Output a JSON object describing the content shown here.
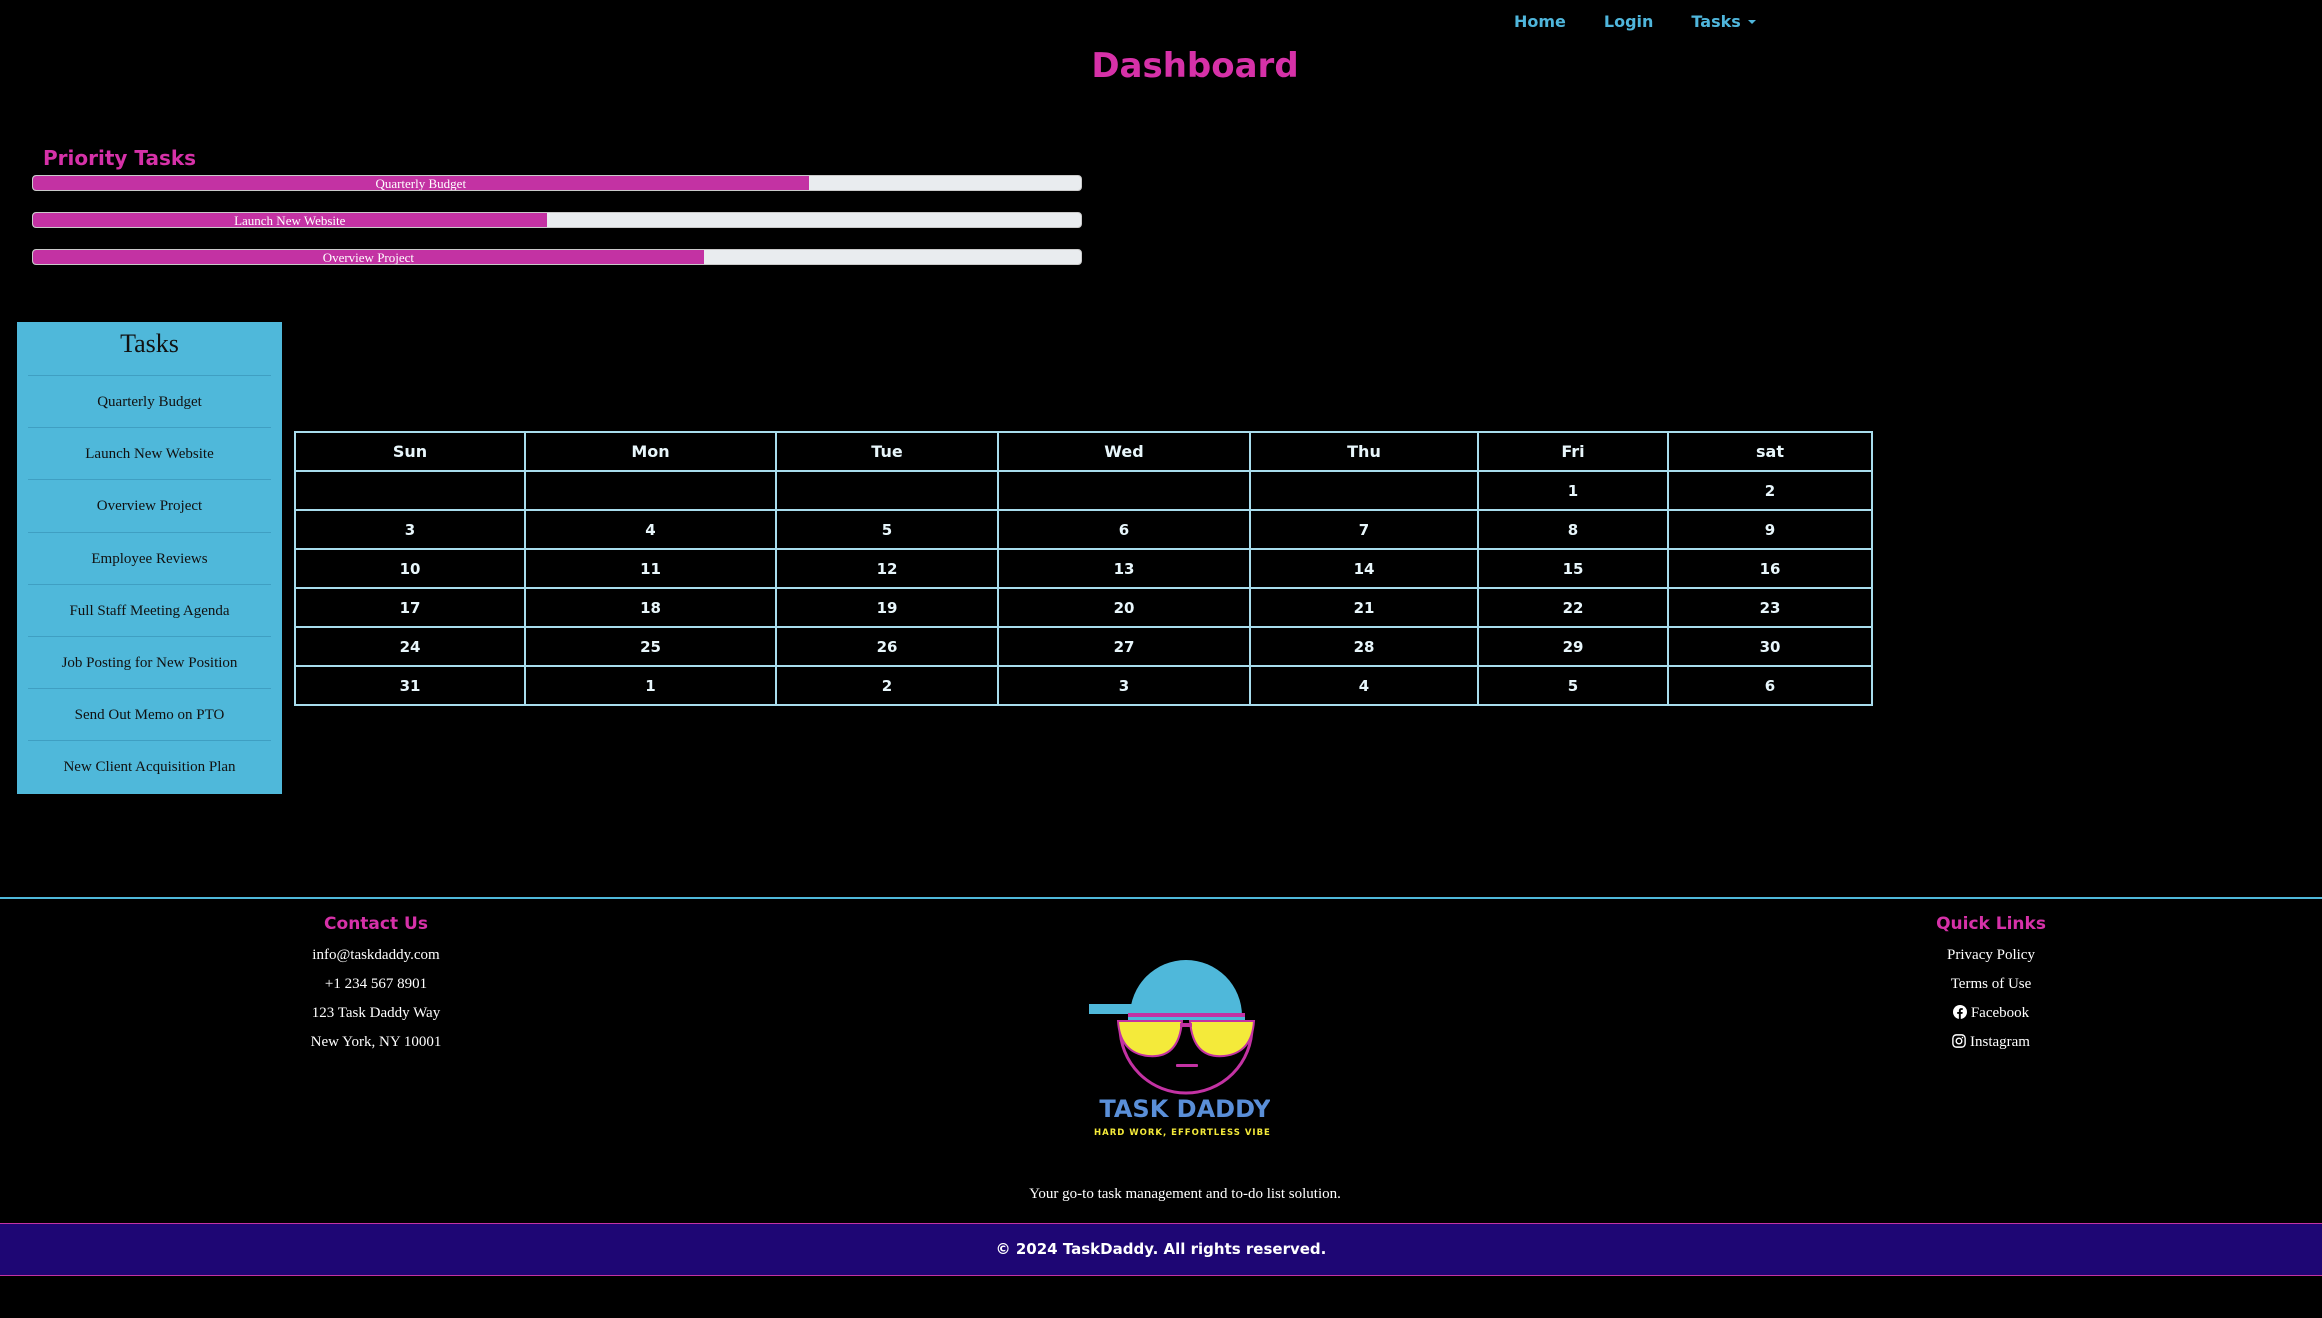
{
  "nav": {
    "home": "Home",
    "login": "Login",
    "tasks": "Tasks"
  },
  "dashboard_title": "Dashboard",
  "priority": {
    "title": "Priority Tasks",
    "items": [
      {
        "label": "Quarterly Budget",
        "progress_pct": 74
      },
      {
        "label": "Launch New Website",
        "progress_pct": 49
      },
      {
        "label": "Overview Project",
        "progress_pct": 64
      }
    ]
  },
  "task_panel": {
    "title": "Tasks",
    "items": [
      "Quarterly Budget",
      "Launch New Website",
      "Overview Project",
      "Employee Reviews",
      "Full Staff Meeting Agenda",
      "Job Posting for New Position",
      "Send Out Memo on PTO",
      "New Client Acquisition Plan"
    ]
  },
  "calendar": {
    "days": [
      "Sun",
      "Mon",
      "Tue",
      "Wed",
      "Thu",
      "Fri",
      "sat"
    ],
    "weeks": [
      [
        "",
        "",
        "",
        "",
        "",
        "1",
        "2"
      ],
      [
        "3",
        "4",
        "5",
        "6",
        "7",
        "8",
        "9"
      ],
      [
        "10",
        "11",
        "12",
        "13",
        "14",
        "15",
        "16"
      ],
      [
        "17",
        "18",
        "19",
        "20",
        "21",
        "22",
        "23"
      ],
      [
        "24",
        "25",
        "26",
        "27",
        "28",
        "29",
        "30"
      ],
      [
        "31",
        "1",
        "2",
        "3",
        "4",
        "5",
        "6"
      ]
    ]
  },
  "contact": {
    "title": "Contact Us",
    "email": "info@taskdaddy.com",
    "phone": "+1 234 567 8901",
    "street": "123 Task Daddy Way",
    "city": "New York, NY 10001"
  },
  "quick_links": {
    "title": "Quick Links",
    "privacy": "Privacy Policy",
    "terms": "Terms of Use",
    "facebook": "Facebook",
    "instagram": "Instagram"
  },
  "logo": {
    "name": "TASK DADDY",
    "slogan": "HARD WORK, EFFORTLESS VIBES"
  },
  "tagline": "Your go-to task management and to-do list solution.",
  "copyright": "© 2024 TaskDaddy. All rights reserved.",
  "colors": {
    "accent_pink": "#d631a8",
    "accent_blue": "#4fb8da",
    "footer_bar": "#1e0674",
    "logo_yellow": "#f4ea3a"
  }
}
